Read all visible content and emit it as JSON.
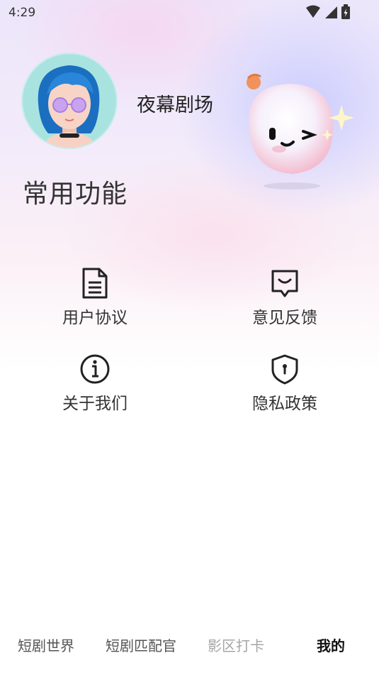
{
  "status_bar": {
    "time": "4:29",
    "icons": [
      "wifi-icon",
      "signal-icon",
      "battery-icon"
    ]
  },
  "profile": {
    "username": "夜幕剧场"
  },
  "section": {
    "title": "常用功能"
  },
  "functions": [
    {
      "label": "用户协议",
      "icon": "document-icon"
    },
    {
      "label": "意见反馈",
      "icon": "feedback-icon"
    },
    {
      "label": "关于我们",
      "icon": "info-icon"
    },
    {
      "label": "隐私政策",
      "icon": "shield-icon"
    }
  ],
  "tabs": [
    {
      "label": "短剧世界",
      "active": false
    },
    {
      "label": "短剧匹配官",
      "active": false
    },
    {
      "label": "影区打卡",
      "active": false
    },
    {
      "label": "我的",
      "active": true
    }
  ],
  "colors": {
    "text": "#333333",
    "inactive_tab": "#a6a6a6",
    "active_tab": "#111111"
  }
}
